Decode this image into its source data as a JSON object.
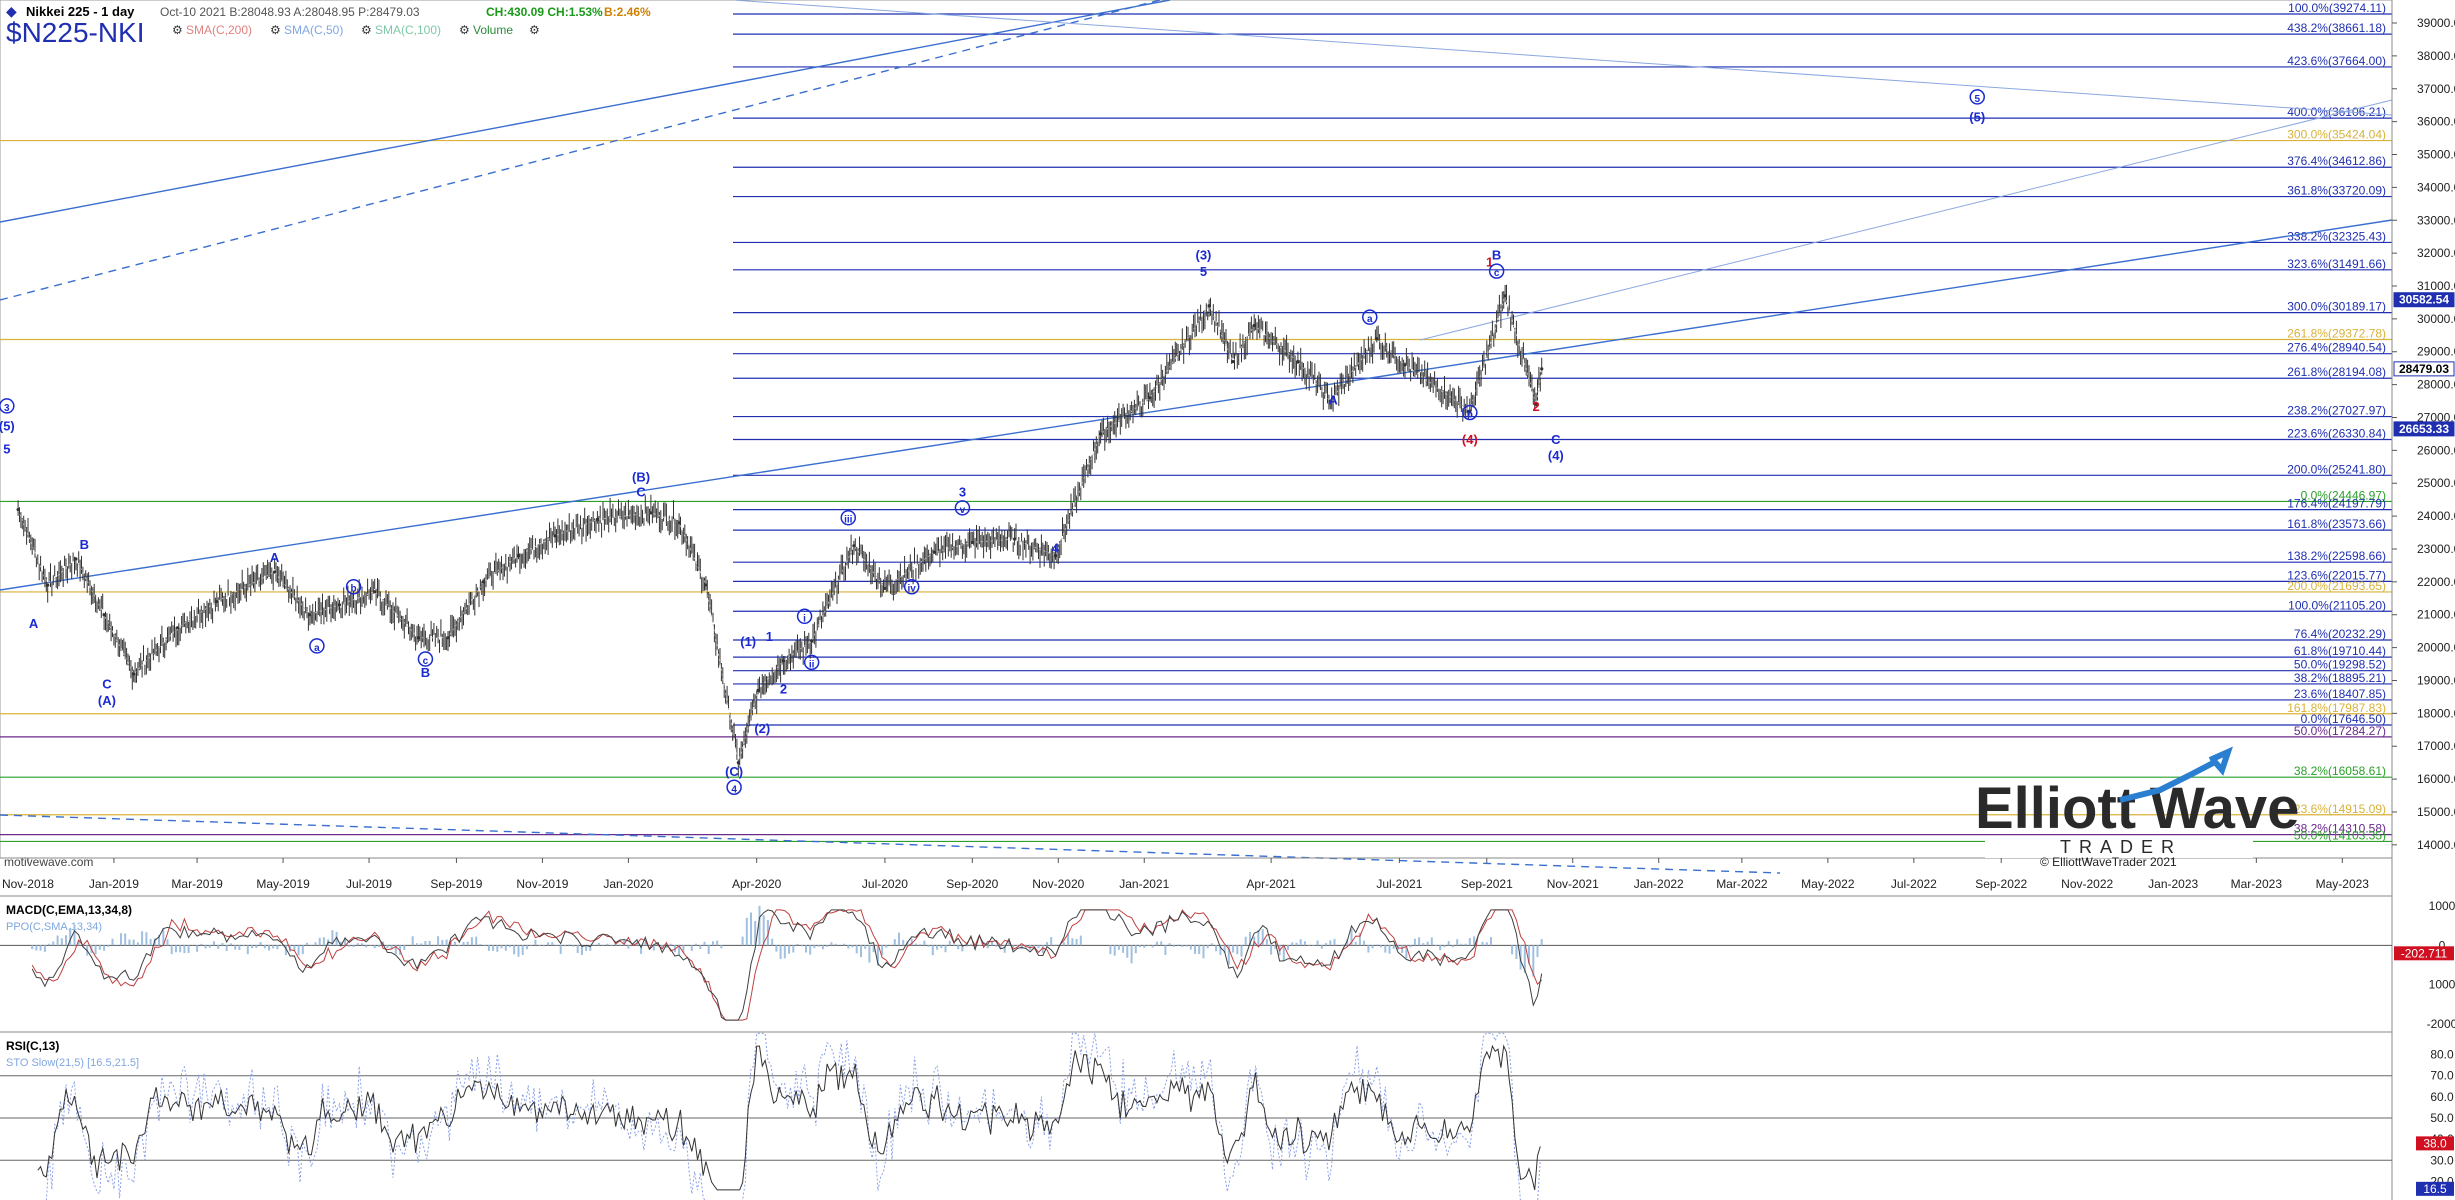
{
  "header": {
    "instrument": "Nikkei 225 - 1 day",
    "ohlc": "Oct-10 2021  B:28048.93  A:28048.95  P:28479.03",
    "change": "CH:430.09  CH:1.53%",
    "bid_pct": "B:2.46%",
    "symbol": "$N225-NKI",
    "indicators": [
      {
        "label": "SMA(C,200)",
        "color": "#e08080"
      },
      {
        "label": "SMA(C,50)",
        "color": "#7fa7e0"
      },
      {
        "label": "SMA(C,100)",
        "color": "#7fc7a7"
      },
      {
        "label": "Volume",
        "color": "#2a8a3a"
      }
    ],
    "watermark": "motivewave.com"
  },
  "colors": {
    "fib_blue": "#1f2fb0",
    "fib_gold": "#d8b23a",
    "fib_green": "#2aa02a",
    "fib_purple": "#6a2a8a",
    "wave_blue": "#1b2bd0",
    "wave_red": "#d01020",
    "trend": "#3a6fd0",
    "price": "#333333"
  },
  "y_axis": {
    "min": 14000,
    "max": 39700,
    "ticks": [
      14000,
      15000,
      16000,
      17000,
      18000,
      19000,
      20000,
      21000,
      22000,
      23000,
      24000,
      25000,
      26000,
      27000,
      28000,
      29000,
      30000,
      31000,
      32000,
      33000,
      34000,
      35000,
      36000,
      37000,
      38000,
      39000
    ],
    "tick_labels": [
      "14000.00",
      "15000.00",
      "16000.00",
      "17000.00",
      "18000.00",
      "19000.00",
      "20000.00",
      "21000.00",
      "22000.00",
      "23000.00",
      "24000.00",
      "25000.00",
      "26000.00",
      "27000.00",
      "28000.00",
      "29000.00",
      "30000.00",
      "31000.00",
      "32000.00",
      "33000.00",
      "34000.00",
      "35000.00",
      "36000.00",
      "37000.00",
      "38000.00",
      "39000.00"
    ],
    "price_tags": [
      {
        "value": 28479.03,
        "label": "28479.03",
        "bg": "#ffffff",
        "fg": "#000000"
      },
      {
        "value": 30582.54,
        "label": "30582.54",
        "bg": "#1f2fb0",
        "fg": "#ffffff"
      },
      {
        "value": 26653.33,
        "label": "26653.33",
        "bg": "#1f2fb0",
        "fg": "#ffffff"
      }
    ]
  },
  "x_axis": {
    "labels": [
      "Nov-2018",
      "Jan-2019",
      "Mar-2019",
      "May-2019",
      "Jul-2019",
      "Sep-2019",
      "Nov-2019",
      "Jan-2020",
      "Apr-2020",
      "Jul-2020",
      "Sep-2020",
      "Nov-2020",
      "Jan-2021",
      "Apr-2021",
      "Jul-2021",
      "Sep-2021",
      "Nov-2021",
      "Jan-2022",
      "Mar-2022",
      "May-2022",
      "Jul-2022",
      "Sep-2022",
      "Nov-2022",
      "Jan-2023",
      "Mar-2023",
      "May-2023"
    ]
  },
  "chart_data": [
    {
      "type": "line",
      "title": "Nikkei 225 - 1 day",
      "ylabel": "",
      "ylim": [
        14000,
        39700
      ],
      "series": [
        {
          "name": "",
          "x": [
            "2018-10-25",
            "2018-11-15",
            "2018-12-05",
            "2018-12-25",
            "2019-01-15",
            "2019-02-15",
            "2019-03-15",
            "2019-04-25",
            "2019-05-20",
            "2019-06-10",
            "2019-07-05",
            "2019-08-05",
            "2019-08-26",
            "2019-09-20",
            "2019-10-15",
            "2019-11-10",
            "2019-12-10",
            "2020-01-17",
            "2020-02-06",
            "2020-02-25",
            "2020-03-19",
            "2020-04-02",
            "2020-04-20",
            "2020-05-10",
            "2020-06-09",
            "2020-07-01",
            "2020-08-05",
            "2020-09-01",
            "2020-10-01",
            "2020-10-30",
            "2020-12-01",
            "2021-01-05",
            "2021-02-16",
            "2021-03-05",
            "2021-03-20",
            "2021-04-20",
            "2021-05-13",
            "2021-06-15",
            "2021-07-05",
            "2021-08-20",
            "2021-09-14",
            "2021-10-06",
            "2021-10-10"
          ],
          "y": [
            24200,
            21900,
            22700,
            21000,
            19200,
            20600,
            21400,
            22300,
            21000,
            21300,
            21700,
            20300,
            20300,
            22000,
            22800,
            23400,
            23900,
            24100,
            23800,
            21900,
            16500,
            18700,
            19600,
            20200,
            23100,
            21800,
            22900,
            23200,
            23300,
            22800,
            26500,
            27600,
            30400,
            28700,
            29800,
            28700,
            27500,
            29400,
            28600,
            27200,
            30700,
            27400,
            28479
          ]
        }
      ],
      "fib_levels": [
        {
          "value": 39274.11,
          "label": "100.0%(39274.11)",
          "color": "blue"
        },
        {
          "value": 38661.18,
          "label": "438.2%(38661.18)",
          "color": "blue"
        },
        {
          "value": 37664.0,
          "label": "423.6%(37664.00)",
          "color": "blue"
        },
        {
          "value": 36106.21,
          "label": "400.0%(36106.21)",
          "color": "blue"
        },
        {
          "value": 35424.04,
          "label": "300.0%(35424.04)",
          "color": "gold"
        },
        {
          "value": 34612.86,
          "label": "376.4%(34612.86)",
          "color": "blue"
        },
        {
          "value": 33720.09,
          "label": "361.8%(33720.09)",
          "color": "blue"
        },
        {
          "value": 32325.43,
          "label": "338.2%(32325.43)",
          "color": "blue"
        },
        {
          "value": 31491.66,
          "label": "323.6%(31491.66)",
          "color": "blue"
        },
        {
          "value": 30189.17,
          "label": "300.0%(30189.17)",
          "color": "blue"
        },
        {
          "value": 29372.78,
          "label": "261.8%(29372.78)",
          "color": "gold"
        },
        {
          "value": 28940.54,
          "label": "276.4%(28940.54)",
          "color": "blue"
        },
        {
          "value": 28194.08,
          "label": "261.8%(28194.08)",
          "color": "blue"
        },
        {
          "value": 27027.97,
          "label": "238.2%(27027.97)",
          "color": "blue"
        },
        {
          "value": 26330.84,
          "label": "223.6%(26330.84)",
          "color": "blue"
        },
        {
          "value": 25241.8,
          "label": "200.0%(25241.80)",
          "color": "blue"
        },
        {
          "value": 24446.97,
          "label": "0.0%(24446.97)",
          "color": "green"
        },
        {
          "value": 24197.79,
          "label": "176.4%(24197.79)",
          "color": "blue"
        },
        {
          "value": 23573.66,
          "label": "161.8%(23573.66)",
          "color": "blue"
        },
        {
          "value": 22598.66,
          "label": "138.2%(22598.66)",
          "color": "blue"
        },
        {
          "value": 22015.77,
          "label": "123.6%(22015.77)",
          "color": "blue"
        },
        {
          "value": 21693.65,
          "label": "200.0%(21693.65)",
          "color": "gold"
        },
        {
          "value": 21105.2,
          "label": "100.0%(21105.20)",
          "color": "blue"
        },
        {
          "value": 20232.29,
          "label": "76.4%(20232.29)",
          "color": "blue"
        },
        {
          "value": 19710.44,
          "label": "61.8%(19710.44)",
          "color": "blue"
        },
        {
          "value": 19298.52,
          "label": "50.0%(19298.52)",
          "color": "blue"
        },
        {
          "value": 18895.21,
          "label": "38.2%(18895.21)",
          "color": "blue"
        },
        {
          "value": 18407.85,
          "label": "23.6%(18407.85)",
          "color": "blue"
        },
        {
          "value": 17987.83,
          "label": "161.8%(17987.83)",
          "color": "gold"
        },
        {
          "value": 17646.5,
          "label": "0.0%(17646.50)",
          "color": "blue"
        },
        {
          "value": 17284.27,
          "label": "50.0%(17284.27)",
          "color": "purple"
        },
        {
          "value": 16058.61,
          "label": "38.2%(16058.61)",
          "color": "green"
        },
        {
          "value": 14915.09,
          "label": "123.6%(14915.09)",
          "color": "gold"
        },
        {
          "value": 14310.58,
          "label": "38.2%(14310.58)",
          "color": "purple"
        },
        {
          "value": 14103.35,
          "label": "50.0%(14103.35)",
          "color": "green"
        }
      ],
      "wave_labels": [
        {
          "text": "3",
          "x": "2018-10-17",
          "y": 27200,
          "color": "blue",
          "circled": true
        },
        {
          "text": "(5)",
          "x": "2018-10-17",
          "y": 26600,
          "color": "blue"
        },
        {
          "text": "5",
          "x": "2018-10-17",
          "y": 25900,
          "color": "blue"
        },
        {
          "text": "B",
          "x": "2018-12-11",
          "y": 23000,
          "color": "blue"
        },
        {
          "text": "A",
          "x": "2018-11-05",
          "y": 20600,
          "color": "blue"
        },
        {
          "text": "C",
          "x": "2018-12-27",
          "y": 18750,
          "color": "blue"
        },
        {
          "text": "(A)",
          "x": "2018-12-27",
          "y": 18250,
          "color": "blue"
        },
        {
          "text": "A",
          "x": "2019-04-25",
          "y": 22600,
          "color": "blue"
        },
        {
          "text": "b",
          "x": "2019-06-20",
          "y": 21700,
          "color": "blue",
          "circled": true
        },
        {
          "text": "a",
          "x": "2019-05-25",
          "y": 19900,
          "color": "blue",
          "circled": true
        },
        {
          "text": "c",
          "x": "2019-08-10",
          "y": 19500,
          "color": "blue",
          "circled": true
        },
        {
          "text": "B",
          "x": "2019-08-10",
          "y": 19100,
          "color": "blue"
        },
        {
          "text": "(B)",
          "x": "2020-01-10",
          "y": 25050,
          "color": "blue"
        },
        {
          "text": "C",
          "x": "2020-01-10",
          "y": 24600,
          "color": "blue"
        },
        {
          "text": "(1)",
          "x": "2020-03-26",
          "y": 20050,
          "color": "blue"
        },
        {
          "text": "1",
          "x": "2020-04-10",
          "y": 20200,
          "color": "blue"
        },
        {
          "text": "2",
          "x": "2020-04-20",
          "y": 18600,
          "color": "blue"
        },
        {
          "text": "(2)",
          "x": "2020-04-05",
          "y": 17400,
          "color": "blue"
        },
        {
          "text": "(C)",
          "x": "2020-03-16",
          "y": 16100,
          "color": "blue"
        },
        {
          "text": "4",
          "x": "2020-03-16",
          "y": 15600,
          "color": "blue",
          "circled": true
        },
        {
          "text": "i",
          "x": "2020-05-05",
          "y": 20800,
          "color": "blue",
          "circled": true
        },
        {
          "text": "ii",
          "x": "2020-05-10",
          "y": 19400,
          "color": "blue",
          "circled": true
        },
        {
          "text": "iii",
          "x": "2020-06-05",
          "y": 23800,
          "color": "blue",
          "circled": true
        },
        {
          "text": "iv",
          "x": "2020-07-20",
          "y": 21700,
          "color": "blue",
          "circled": true
        },
        {
          "text": "v",
          "x": "2020-08-25",
          "y": 24100,
          "color": "blue",
          "circled": true
        },
        {
          "text": "3",
          "x": "2020-08-25",
          "y": 24600,
          "color": "blue"
        },
        {
          "text": "4",
          "x": "2020-10-30",
          "y": 22900,
          "color": "blue"
        },
        {
          "text": "(3)",
          "x": "2021-02-12",
          "y": 31800,
          "color": "blue"
        },
        {
          "text": "5",
          "x": "2021-02-12",
          "y": 31300,
          "color": "blue"
        },
        {
          "text": "A",
          "x": "2021-05-15",
          "y": 27400,
          "color": "blue"
        },
        {
          "text": "a",
          "x": "2021-06-10",
          "y": 29900,
          "color": "blue",
          "circled": true
        },
        {
          "text": "b",
          "x": "2021-08-20",
          "y": 27000,
          "color": "blue",
          "circled": true
        },
        {
          "text": "(4)",
          "x": "2021-08-20",
          "y": 26200,
          "color": "red"
        },
        {
          "text": "1",
          "x": "2021-09-03",
          "y": 31600,
          "color": "red"
        },
        {
          "text": "B",
          "x": "2021-09-08",
          "y": 31800,
          "color": "blue"
        },
        {
          "text": "c",
          "x": "2021-09-08",
          "y": 31300,
          "color": "blue",
          "circled": true
        },
        {
          "text": "2",
          "x": "2021-10-06",
          "y": 27200,
          "color": "red"
        },
        {
          "text": "C",
          "x": "2021-10-20",
          "y": 26200,
          "color": "blue"
        },
        {
          "text": "(4)",
          "x": "2021-10-20",
          "y": 25700,
          "color": "blue"
        },
        {
          "text": "5",
          "x": "2022-08-15",
          "y": 36600,
          "color": "blue",
          "circled": true
        },
        {
          "text": "(5)",
          "x": "2022-08-15",
          "y": 36000,
          "color": "blue"
        }
      ]
    },
    {
      "type": "line",
      "title": "MACD(C,EMA,13,34,8)",
      "subtitle": "PPO(C,SMA,13,34)",
      "ylim": [
        -2000,
        1000
      ],
      "y_ticks": [
        1000,
        0,
        -1000,
        -2000
      ],
      "tick_labels": [
        "1000",
        "0",
        "1000",
        "-2000"
      ],
      "current_value": "-202.711"
    },
    {
      "type": "line",
      "title": "RSI(C,13)",
      "subtitle": "STO Slow(21,5) [16.5,21.5]",
      "ylim": [
        20,
        80
      ],
      "y_ticks": [
        80,
        70,
        60,
        50,
        40,
        30,
        20
      ],
      "tick_labels": [
        "80.0",
        "70.0",
        "60.0",
        "50.0",
        "40.0",
        "30.0",
        "20.0"
      ],
      "current_value": "38.0",
      "secondary_value": "16.5"
    }
  ],
  "logo": {
    "word1": "Elliott",
    "word2": "Wave",
    "sub": "TRADER",
    "copyright": "© ElliottWaveTrader 2021"
  }
}
